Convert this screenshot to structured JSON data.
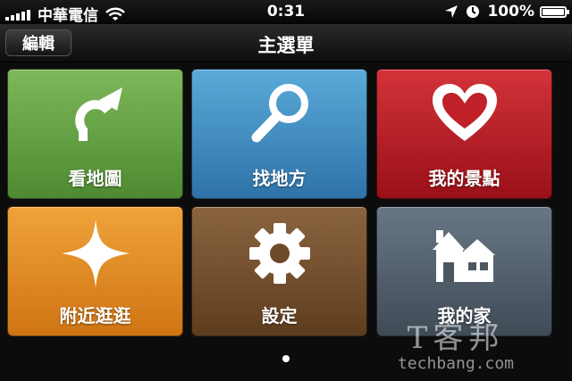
{
  "status_bar": {
    "carrier": "中華電信",
    "time": "0:31",
    "battery_text": "100%",
    "icons": [
      "signal-bars-icon",
      "wifi-icon",
      "location-arrow-icon",
      "clock-icon",
      "battery-icon"
    ],
    "battery_level": 1.0
  },
  "nav_bar": {
    "edit_label": "編輯",
    "title": "主選單"
  },
  "tiles": [
    {
      "label": "看地圖",
      "icon": "route-arrow-icon",
      "color": "#6aa64a"
    },
    {
      "label": "找地方",
      "icon": "magnifier-icon",
      "color": "#4590c4"
    },
    {
      "label": "我的景點",
      "icon": "heart-icon",
      "color": "#b8202a"
    },
    {
      "label": "附近逛逛",
      "icon": "compass-star-icon",
      "color": "#e58b27"
    },
    {
      "label": "設定",
      "icon": "gear-icon",
      "color": "#76512f"
    },
    {
      "label": "我的家",
      "icon": "house-icon",
      "color": "#54616e"
    }
  ],
  "pagination": {
    "current_page": 1,
    "total_pages": 1
  },
  "watermark": {
    "chinese": "T客邦",
    "english": "techbang.com"
  },
  "colors": {
    "background": "#0c0c0c",
    "nav_bar": "#1e1e1e"
  }
}
